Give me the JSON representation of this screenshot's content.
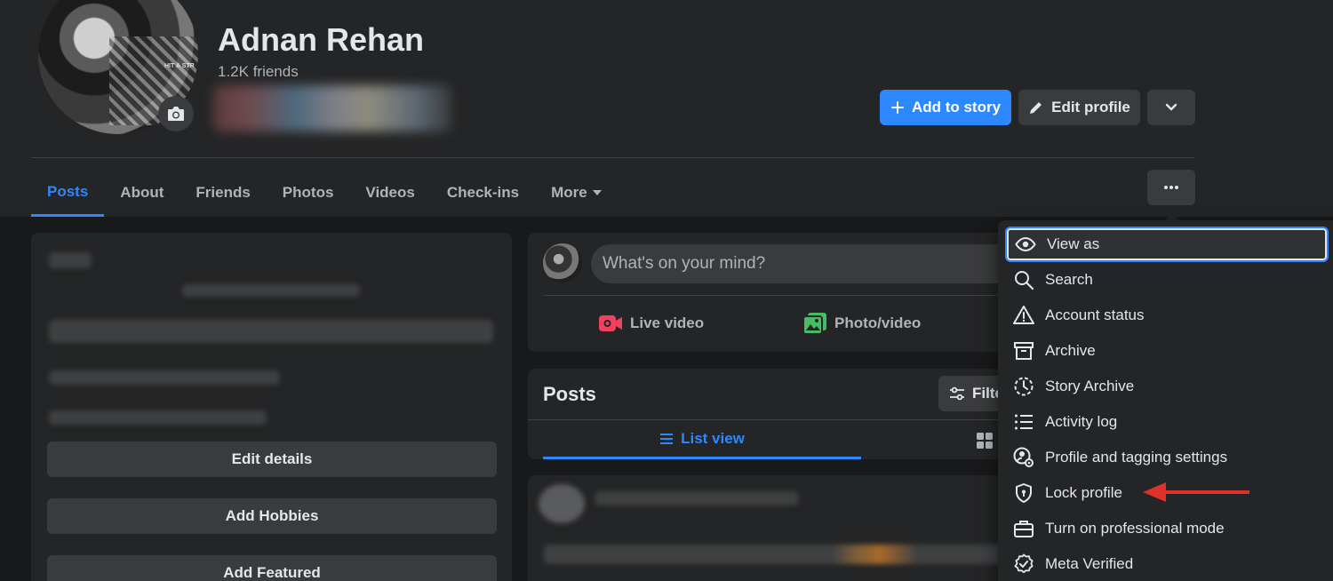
{
  "profile": {
    "name": "Adnan Rehan",
    "friends": "1.2K friends",
    "avatar_text": "HIT A STR"
  },
  "actions": {
    "add_story": "Add to story",
    "edit_profile": "Edit profile"
  },
  "tabs": [
    {
      "label": "Posts"
    },
    {
      "label": "About"
    },
    {
      "label": "Friends"
    },
    {
      "label": "Photos"
    },
    {
      "label": "Videos"
    },
    {
      "label": "Check-ins"
    },
    {
      "label": "More"
    }
  ],
  "intro": {
    "buttons": [
      "Edit details",
      "Add Hobbies",
      "Add Featured"
    ]
  },
  "composer": {
    "placeholder": "What's on your mind?",
    "live_video": "Live video",
    "photo_video": "Photo/video"
  },
  "posts": {
    "title": "Posts",
    "filter": "Filte",
    "list_view": "List view"
  },
  "menu": {
    "items": [
      {
        "label": "View as",
        "icon": "eye-icon"
      },
      {
        "label": "Search",
        "icon": "search-icon"
      },
      {
        "label": "Account status",
        "icon": "warning-icon"
      },
      {
        "label": "Archive",
        "icon": "archive-icon"
      },
      {
        "label": "Story Archive",
        "icon": "clock-history-icon"
      },
      {
        "label": "Activity log",
        "icon": "list-icon"
      },
      {
        "label": "Profile and tagging settings",
        "icon": "user-gear-icon"
      },
      {
        "label": "Lock profile",
        "icon": "shield-icon"
      },
      {
        "label": "Turn on professional mode",
        "icon": "briefcase-icon"
      },
      {
        "label": "Meta Verified",
        "icon": "verified-badge-icon"
      }
    ]
  },
  "colors": {
    "accent": "#2d88ff",
    "arrow": "#e0302a",
    "live": "#f3425f",
    "photo": "#45bd62"
  }
}
